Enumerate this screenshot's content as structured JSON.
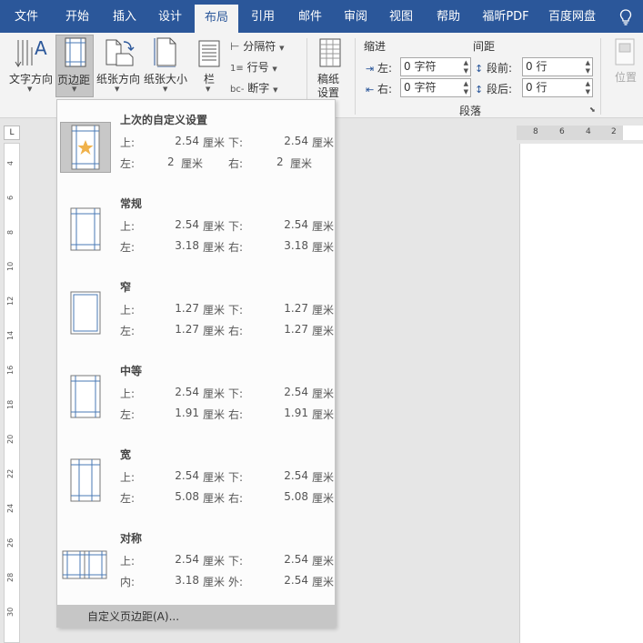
{
  "tabs": [
    "文件",
    "开始",
    "插入",
    "设计",
    "布局",
    "引用",
    "邮件",
    "审阅",
    "视图",
    "帮助",
    "福昕PDF",
    "百度网盘"
  ],
  "active_tab": "布局",
  "ribbon": {
    "text_direction": "文字方向",
    "margins": "页边距",
    "orientation": "纸张方向",
    "size": "纸张大小",
    "columns": "栏",
    "breaks": "分隔符",
    "line_numbers": "行号",
    "hyphenation": "断字",
    "manuscript_line1": "稿纸",
    "manuscript_line2": "设置",
    "indent_title": "缩进",
    "indent_left_label": "左:",
    "indent_left_value": "0 字符",
    "indent_right_label": "右:",
    "indent_right_value": "0 字符",
    "spacing_title": "间距",
    "spacing_before_label": "段前:",
    "spacing_before_value": "0 行",
    "spacing_after_label": "段后:",
    "spacing_after_value": "0 行",
    "paragraph_group": "段落",
    "position": "位置"
  },
  "ruler": {
    "corner": "L",
    "horizontal": [
      "8",
      "6",
      "4",
      "2"
    ],
    "vertical": [
      "4",
      "6",
      "8",
      "10",
      "12",
      "14",
      "16",
      "18",
      "20",
      "22",
      "24",
      "26",
      "28",
      "30"
    ]
  },
  "margin_presets": [
    {
      "name": "上次的自定义设置",
      "labels": [
        "上:",
        "下:",
        "左:",
        "右:"
      ],
      "values": [
        "2.54",
        "2.54",
        "2",
        "2"
      ]
    },
    {
      "name": "常规",
      "labels": [
        "上:",
        "下:",
        "左:",
        "右:"
      ],
      "values": [
        "2.54",
        "2.54",
        "3.18",
        "3.18"
      ]
    },
    {
      "name": "窄",
      "labels": [
        "上:",
        "下:",
        "左:",
        "右:"
      ],
      "values": [
        "1.27",
        "1.27",
        "1.27",
        "1.27"
      ]
    },
    {
      "name": "中等",
      "labels": [
        "上:",
        "下:",
        "左:",
        "右:"
      ],
      "values": [
        "2.54",
        "2.54",
        "1.91",
        "1.91"
      ]
    },
    {
      "name": "宽",
      "labels": [
        "上:",
        "下:",
        "左:",
        "右:"
      ],
      "values": [
        "2.54",
        "2.54",
        "5.08",
        "5.08"
      ]
    },
    {
      "name": "对称",
      "labels": [
        "上:",
        "下:",
        "内:",
        "外:"
      ],
      "values": [
        "2.54",
        "2.54",
        "3.18",
        "2.54"
      ]
    }
  ],
  "unit": "厘米",
  "custom_margins": "自定义页边距(A)...",
  "colors": {
    "tab_bar": "#2b579a",
    "ribbon": "#f3f3f3",
    "star": "#f0b24b",
    "margin_line": "#4a7ab5"
  },
  "icons": {
    "bulb": "lightbulb-icon",
    "star": "star-icon"
  }
}
